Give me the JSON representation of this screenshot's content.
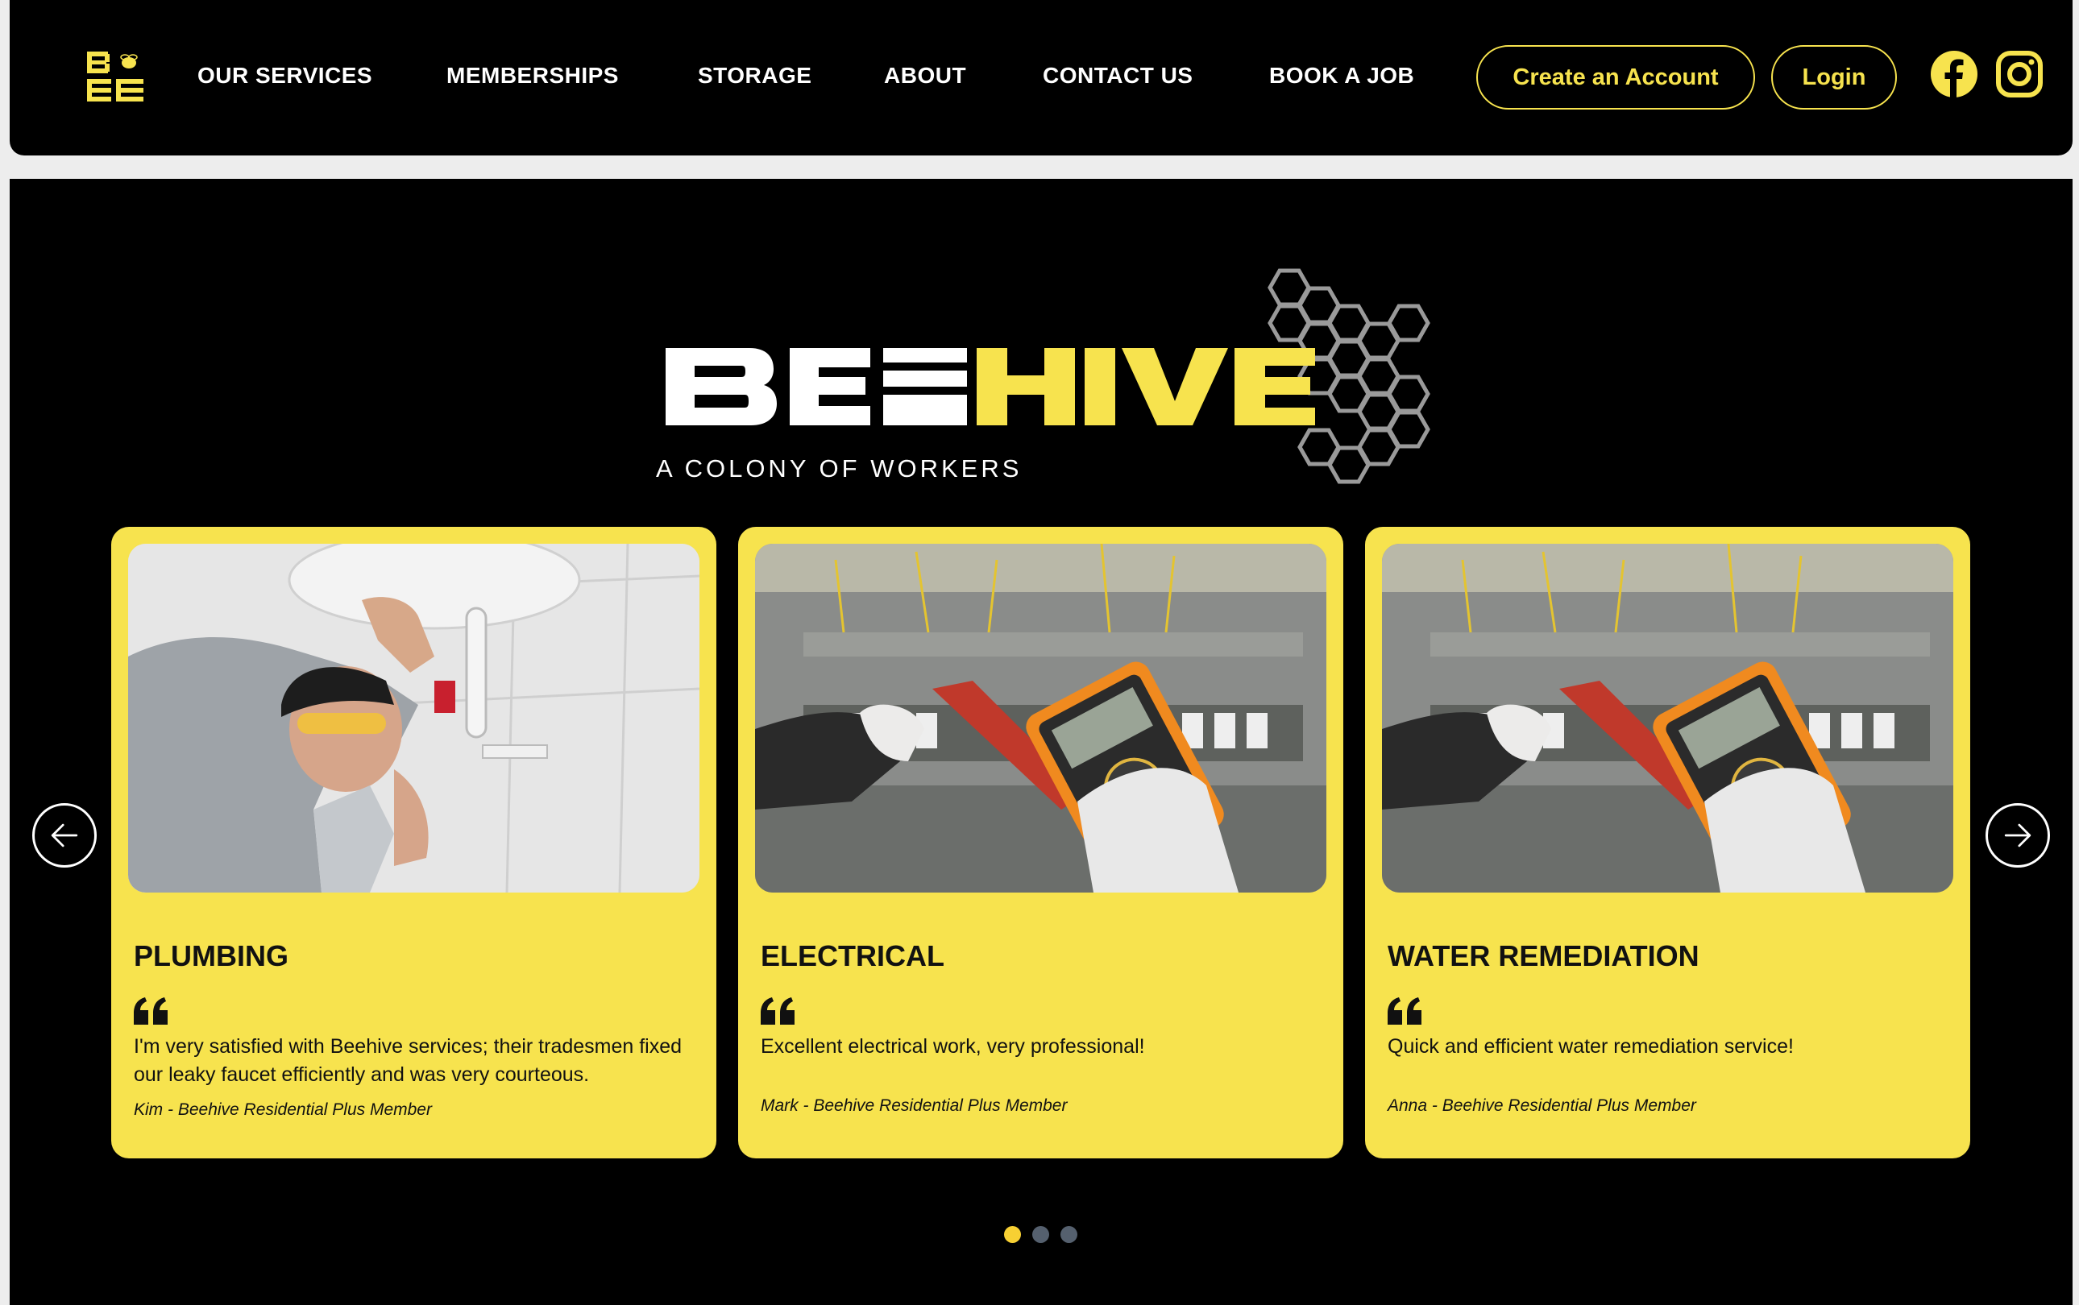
{
  "nav": {
    "logo_alt": "BEE",
    "links": [
      "OUR SERVICES",
      "MEMBERSHIPS",
      "STORAGE",
      "ABOUT",
      "CONTACT US",
      "BOOK A JOB"
    ],
    "create_account": "Create an Account",
    "login": "Login",
    "social": [
      "facebook-icon",
      "instagram-icon"
    ]
  },
  "hero": {
    "brand_white": "BEE",
    "brand_yellow": "HIVE",
    "tagline": "A COLONY OF WORKERS"
  },
  "testimonials": [
    {
      "title": "PLUMBING",
      "quote": "I'm very satisfied with Beehive services; their tradesmen fixed our leaky faucet efficiently and was very courteous.",
      "author": "Kim - Beehive Residential Plus Member"
    },
    {
      "title": "ELECTRICAL",
      "quote": "Excellent electrical work, very professional!",
      "author": "Mark - Beehive Residential Plus Member"
    },
    {
      "title": "WATER REMEDIATION",
      "quote": "Quick and efficient water remediation service!",
      "author": "Anna - Beehive Residential Plus Member"
    }
  ],
  "carousel": {
    "pages": 3,
    "active": 1
  },
  "colors": {
    "accent": "#f7e34e",
    "background": "#000000",
    "page": "#ededed",
    "dot_inactive": "#55606e",
    "dot_active": "#f7d033"
  }
}
